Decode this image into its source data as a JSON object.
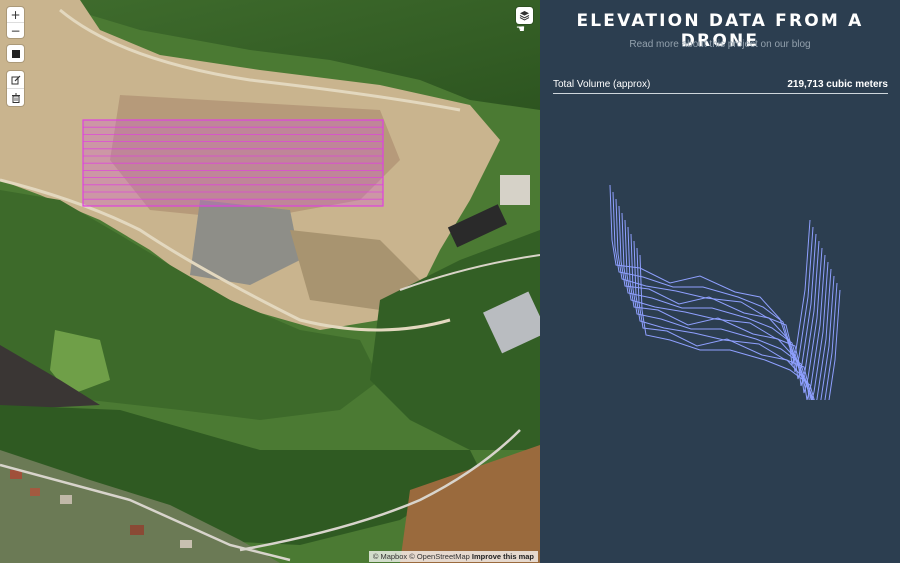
{
  "map": {
    "zoom_in_label": "+",
    "zoom_out_label": "−",
    "attribution": {
      "mapbox": "© Mapbox",
      "osm": "© OpenStreetMap",
      "improve": "Improve this map"
    }
  },
  "panel": {
    "title": "ELEVATION DATA FROM A DRONE",
    "subtitle": "Read more about this project on our blog",
    "volume_label": "Total Volume (approx)",
    "volume_value": "219,713 cubic meters"
  },
  "colors": {
    "panel_bg": "#2c3e50",
    "profile_line": "#8fa0ff",
    "selection_stroke": "#e040e0",
    "selection_fill": "#d060d0"
  },
  "icons": [
    "zoom-in-icon",
    "zoom-out-icon",
    "square-icon",
    "edit-icon",
    "trash-icon",
    "layers-icon",
    "hand-cursor-icon"
  ]
}
